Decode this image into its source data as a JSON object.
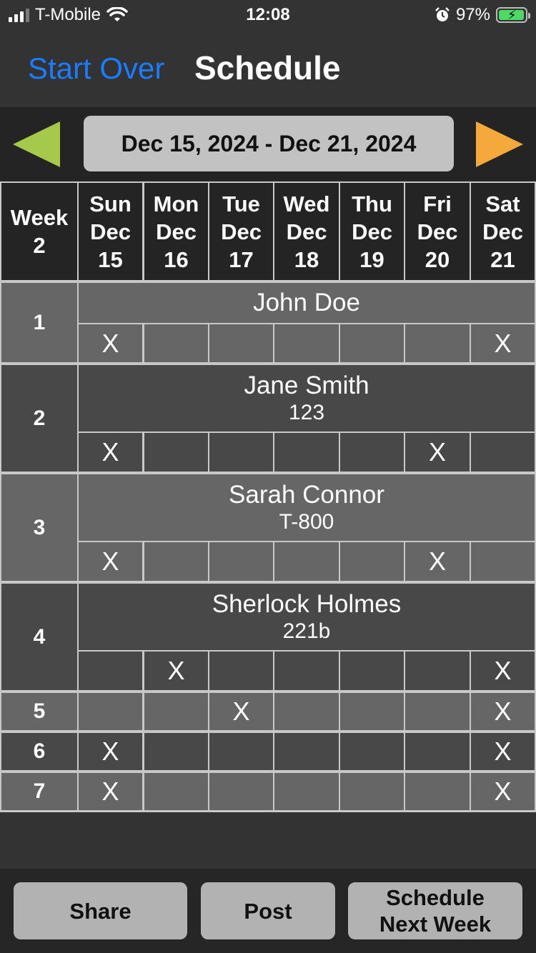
{
  "status_bar": {
    "carrier": "T-Mobile",
    "time": "12:08",
    "battery_percent": "97%",
    "battery_level": 0.97
  },
  "nav": {
    "start_over_label": "Start Over",
    "title": "Schedule"
  },
  "week_selector": {
    "range_label": "Dec 15, 2024 - Dec 21, 2024",
    "prev_color": "#a5c94a",
    "next_color": "#f5a93a"
  },
  "table_header": {
    "week_label": "Week",
    "week_number": "2",
    "days": [
      {
        "dow": "Sun",
        "month": "Dec",
        "date": "15"
      },
      {
        "dow": "Mon",
        "month": "Dec",
        "date": "16"
      },
      {
        "dow": "Tue",
        "month": "Dec",
        "date": "17"
      },
      {
        "dow": "Wed",
        "month": "Dec",
        "date": "18"
      },
      {
        "dow": "Thu",
        "month": "Dec",
        "date": "19"
      },
      {
        "dow": "Fri",
        "month": "Dec",
        "date": "20"
      },
      {
        "dow": "Sat",
        "month": "Dec",
        "date": "21"
      }
    ]
  },
  "rows": [
    {
      "num": "1",
      "name": "John Doe",
      "detail": "",
      "marks": [
        "X",
        "",
        "",
        "",
        "",
        "",
        "X"
      ]
    },
    {
      "num": "2",
      "name": "Jane Smith",
      "detail": "123",
      "marks": [
        "X",
        "",
        "",
        "",
        "",
        "X",
        ""
      ]
    },
    {
      "num": "3",
      "name": "Sarah Connor",
      "detail": "T-800",
      "marks": [
        "X",
        "",
        "",
        "",
        "",
        "X",
        ""
      ]
    },
    {
      "num": "4",
      "name": "Sherlock Holmes",
      "detail": "221b",
      "marks": [
        "",
        "X",
        "",
        "",
        "",
        "",
        "X"
      ]
    },
    {
      "num": "5",
      "name": "",
      "detail": "",
      "marks": [
        "",
        "",
        "X",
        "",
        "",
        "",
        "X"
      ]
    },
    {
      "num": "6",
      "name": "",
      "detail": "",
      "marks": [
        "X",
        "",
        "",
        "",
        "",
        "",
        "X"
      ]
    },
    {
      "num": "7",
      "name": "",
      "detail": "",
      "marks": [
        "X",
        "",
        "",
        "",
        "",
        "",
        "X"
      ]
    }
  ],
  "bottom_bar": {
    "share_label": "Share",
    "post_label": "Post",
    "schedule_next_line1": "Schedule",
    "schedule_next_line2": "Next Week"
  },
  "colors": {
    "accent_blue": "#1a7cff",
    "row_light": "#666666",
    "row_dark": "#484848"
  }
}
